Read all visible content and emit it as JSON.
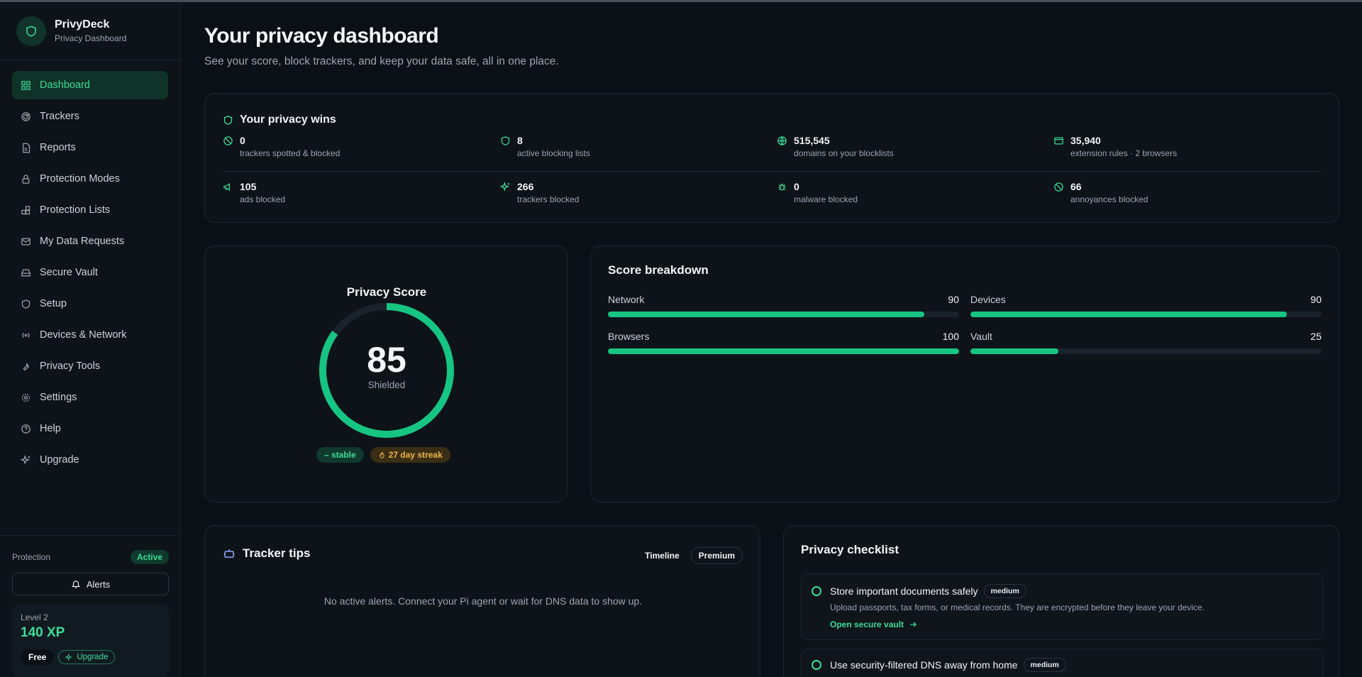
{
  "brand": {
    "name": "PrivyDeck",
    "subtitle": "Privacy Dashboard"
  },
  "sidebar": {
    "items": [
      {
        "label": "Dashboard",
        "icon": "grid-icon",
        "active": true
      },
      {
        "label": "Trackers",
        "icon": "radar-icon"
      },
      {
        "label": "Reports",
        "icon": "file-icon"
      },
      {
        "label": "Protection Modes",
        "icon": "lock-icon"
      },
      {
        "label": "Protection Lists",
        "icon": "blocks-icon"
      },
      {
        "label": "My Data Requests",
        "icon": "mail-icon"
      },
      {
        "label": "Secure Vault",
        "icon": "drive-icon"
      },
      {
        "label": "Setup",
        "icon": "shield-icon"
      },
      {
        "label": "Devices & Network",
        "icon": "radio-icon"
      },
      {
        "label": "Privacy Tools",
        "icon": "wrench-icon"
      },
      {
        "label": "Settings",
        "icon": "gear-icon"
      },
      {
        "label": "Help",
        "icon": "help-icon"
      },
      {
        "label": "Upgrade",
        "icon": "sparkle-icon"
      }
    ],
    "protection_label": "Protection",
    "protection_status": "Active",
    "alerts_label": "Alerts",
    "level": "Level 2",
    "xp": "140 XP",
    "plan": "Free",
    "upgrade_label": "Upgrade"
  },
  "header": {
    "title": "Your privacy dashboard",
    "subtitle": "See your score, block trackers, and keep your data safe, all in one place."
  },
  "wins": {
    "title": "Your privacy wins",
    "stats": [
      {
        "value": "0",
        "label": "trackers spotted & blocked",
        "icon": "ban-icon"
      },
      {
        "value": "8",
        "label": "active blocking lists",
        "icon": "shield-icon"
      },
      {
        "value": "515,545",
        "label": "domains on your blocklists",
        "icon": "globe-icon"
      },
      {
        "value": "35,940",
        "label": "extension rules · 2 browsers",
        "icon": "browser-icon"
      },
      {
        "value": "105",
        "label": "ads blocked",
        "icon": "megaphone-icon"
      },
      {
        "value": "266",
        "label": "trackers blocked",
        "icon": "sparkle-icon"
      },
      {
        "value": "0",
        "label": "malware blocked",
        "icon": "bug-icon"
      },
      {
        "value": "66",
        "label": "annoyances blocked",
        "icon": "ban-icon"
      }
    ]
  },
  "score": {
    "title": "Privacy Score",
    "value": "85",
    "fraction": 0.85,
    "state": "Shielded",
    "trend": "– stable",
    "streak": "27 day streak"
  },
  "breakdown": {
    "title": "Score breakdown",
    "items": [
      {
        "label": "Network",
        "value": "90",
        "fraction": 0.9
      },
      {
        "label": "Devices",
        "value": "90",
        "fraction": 0.9
      },
      {
        "label": "Browsers",
        "value": "100",
        "fraction": 1.0
      },
      {
        "label": "Vault",
        "value": "25",
        "fraction": 0.25
      }
    ]
  },
  "tips": {
    "title": "Tracker tips",
    "tabs": [
      "Timeline",
      "Premium"
    ],
    "selected_tab": "Premium",
    "empty": "No active alerts. Connect your Pi agent or wait for DNS data to show up."
  },
  "checklist": {
    "title": "Privacy checklist",
    "items": [
      {
        "name": "Store important documents safely",
        "badge": "medium",
        "desc": "Upload passports, tax forms, or medical records. They are encrypted before they leave your device.",
        "link": "Open secure vault"
      },
      {
        "name": "Use security-filtered DNS away from home",
        "badge": "medium"
      }
    ]
  },
  "colors": {
    "accent": "#3ddc97",
    "bar": "#17c583",
    "streak": "#f0b44a",
    "background": "#0b1016"
  }
}
